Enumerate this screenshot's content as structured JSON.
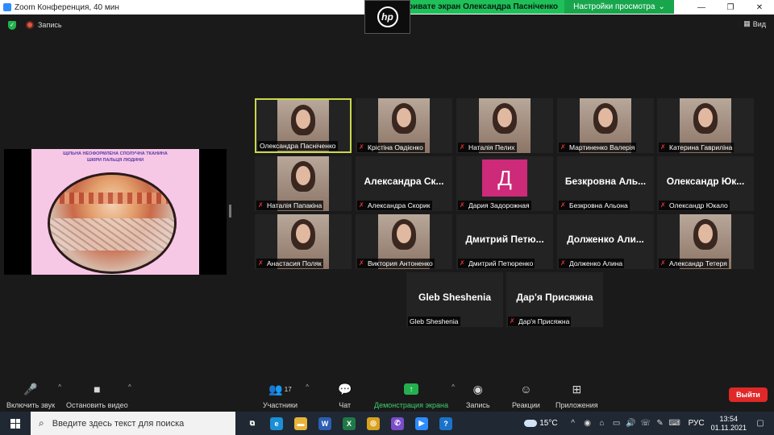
{
  "window": {
    "title": "Zoom Конференция, 40 мин",
    "minimize": "—",
    "maximize": "❐",
    "close": "✕"
  },
  "share_banner": {
    "text": "тривате экран Олександра  Пасніченко",
    "view_settings": "Настройки просмотра",
    "view_settings_caret": "⌄"
  },
  "hp_logo": "hp",
  "header": {
    "shield": "✓",
    "record_label": "Запись",
    "view_label": "Вид",
    "view_icon": "▦"
  },
  "slide": {
    "title": "ЩІЛЬНА НЕОФОРМЛЕНА СПОЛУЧНА ТКАНИНА ШКІРИ ПАЛЬЦЯ ЛЮДИНИ"
  },
  "participants": [
    {
      "label": "Олександра  Пасніченко",
      "muted": false,
      "video": true,
      "active": true
    },
    {
      "label": "Крістіна Овдієнко",
      "muted": true,
      "video": true
    },
    {
      "label": "Наталія Пелих",
      "muted": true,
      "video": true
    },
    {
      "label": "Мартиненко Валерія",
      "muted": true,
      "video": true
    },
    {
      "label": "Катерина Гаврилiна",
      "muted": true,
      "video": true
    },
    {
      "label": "Наталія Папакіна",
      "muted": true,
      "video": true
    },
    {
      "label": "Александра Скорик",
      "bigname": "Александра  Ск...",
      "muted": true,
      "video": false
    },
    {
      "label": "Дария Задорожная",
      "avatar": "Д",
      "muted": true,
      "video": false
    },
    {
      "label": "Безкровна Альона",
      "bigname": "Безкровна  Аль...",
      "muted": true,
      "video": false
    },
    {
      "label": "Олександр Юкало",
      "bigname": "Олександр  Юк...",
      "muted": true,
      "video": false
    },
    {
      "label": "Анастасия Поляк",
      "muted": true,
      "video": true
    },
    {
      "label": "Виктория Антоненко",
      "muted": true,
      "video": true
    },
    {
      "label": "Дмитрий Петюренко",
      "bigname": "Дмитрий  Петю...",
      "muted": true,
      "video": false
    },
    {
      "label": "Долженко Алина",
      "bigname": "Долженко  Али...",
      "muted": true,
      "video": false
    },
    {
      "label": "Александр Тетеря",
      "muted": true,
      "video": true
    },
    {
      "label": "Gleb Sheshenia",
      "bigname": "Gleb Sheshenia",
      "muted": false,
      "video": false
    },
    {
      "label": "Дар'я Присяжна",
      "bigname": "Дар'я Присяжна",
      "muted": true,
      "video": false
    }
  ],
  "toolbar": {
    "audio": "Включить звук",
    "video": "Остановить видео",
    "participants": "Участники",
    "participants_count": "17",
    "chat": "Чат",
    "share": "Демонстрация экрана",
    "record": "Запись",
    "reactions": "Реакции",
    "apps": "Приложения",
    "exit": "Выйти",
    "caret": "^",
    "share_icon": "↑",
    "audio_icon": "🎤",
    "video_icon": "■",
    "participants_icon": "👥",
    "chat_icon": "💬",
    "record_icon": "◉",
    "reactions_icon": "☺",
    "apps_icon": "⊞"
  },
  "taskbar": {
    "search_placeholder": "Введите здесь текст для поиска",
    "search_icon": "⌕",
    "weather": "15°C",
    "lang": "РУС",
    "time": "13:54",
    "date": "01.11.2021",
    "apps": [
      {
        "name": "task-view",
        "glyph": "⧉",
        "color": "transparent"
      },
      {
        "name": "edge",
        "glyph": "e",
        "color": "#1b8fd6"
      },
      {
        "name": "explorer",
        "glyph": "▬",
        "color": "#e8b33a"
      },
      {
        "name": "word",
        "glyph": "W",
        "color": "#2b5fb3"
      },
      {
        "name": "excel",
        "glyph": "X",
        "color": "#1e7a45"
      },
      {
        "name": "chrome",
        "glyph": "◎",
        "color": "#d8a21e"
      },
      {
        "name": "viber",
        "glyph": "✆",
        "color": "#7b4dc9"
      },
      {
        "name": "zoom",
        "glyph": "▶",
        "color": "#2d8cff"
      },
      {
        "name": "help",
        "glyph": "?",
        "color": "#1a73c9"
      }
    ],
    "tray": [
      "^",
      "◉",
      "⌂",
      "▭",
      "🔊",
      "☏",
      "✎",
      "⌨"
    ],
    "notification": "▢"
  }
}
